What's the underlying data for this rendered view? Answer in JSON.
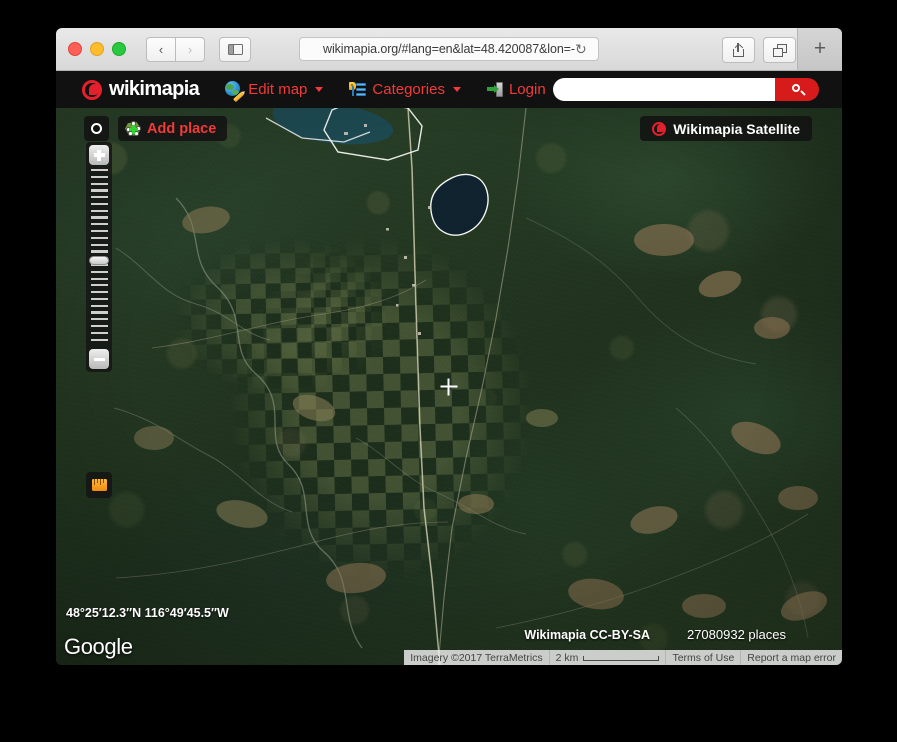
{
  "browser": {
    "url": "wikimapia.org/#lang=en&lat=48.420087&lon=-",
    "back_label": "‹",
    "forward_label": "›",
    "reload_label": "↻",
    "newtab_label": "+",
    "window_buttons": [
      "close",
      "minimize",
      "zoom"
    ]
  },
  "nav": {
    "brand": "wikimapia",
    "items": [
      {
        "label": "Edit map",
        "icon": "globe-pencil-icon"
      },
      {
        "label": "Categories",
        "icon": "category-list-icon"
      },
      {
        "label": "Login",
        "icon": "login-door-icon"
      }
    ],
    "search": {
      "value": "",
      "placeholder": ""
    }
  },
  "map": {
    "add_place_label": "Add place",
    "satellite_label": "Wikimapia Satellite",
    "coordinates": "48°25′12.3″N 116°49′45.5″W",
    "google_logo": "Google",
    "wikimapia_credit": "Wikimapia CC-BY-SA",
    "places_count": "27080932 places",
    "imagery_credit": "Imagery ©2017 TerraMetrics",
    "scale_label": "2 km",
    "terms_label": "Terms of Use",
    "report_label": "Report a map error",
    "colors": {
      "brand_red": "#e4202c",
      "link_red": "#f23a3a",
      "search_red": "#d71b1b",
      "nav_black": "#111111",
      "ruler_orange": "#f08a12"
    }
  }
}
